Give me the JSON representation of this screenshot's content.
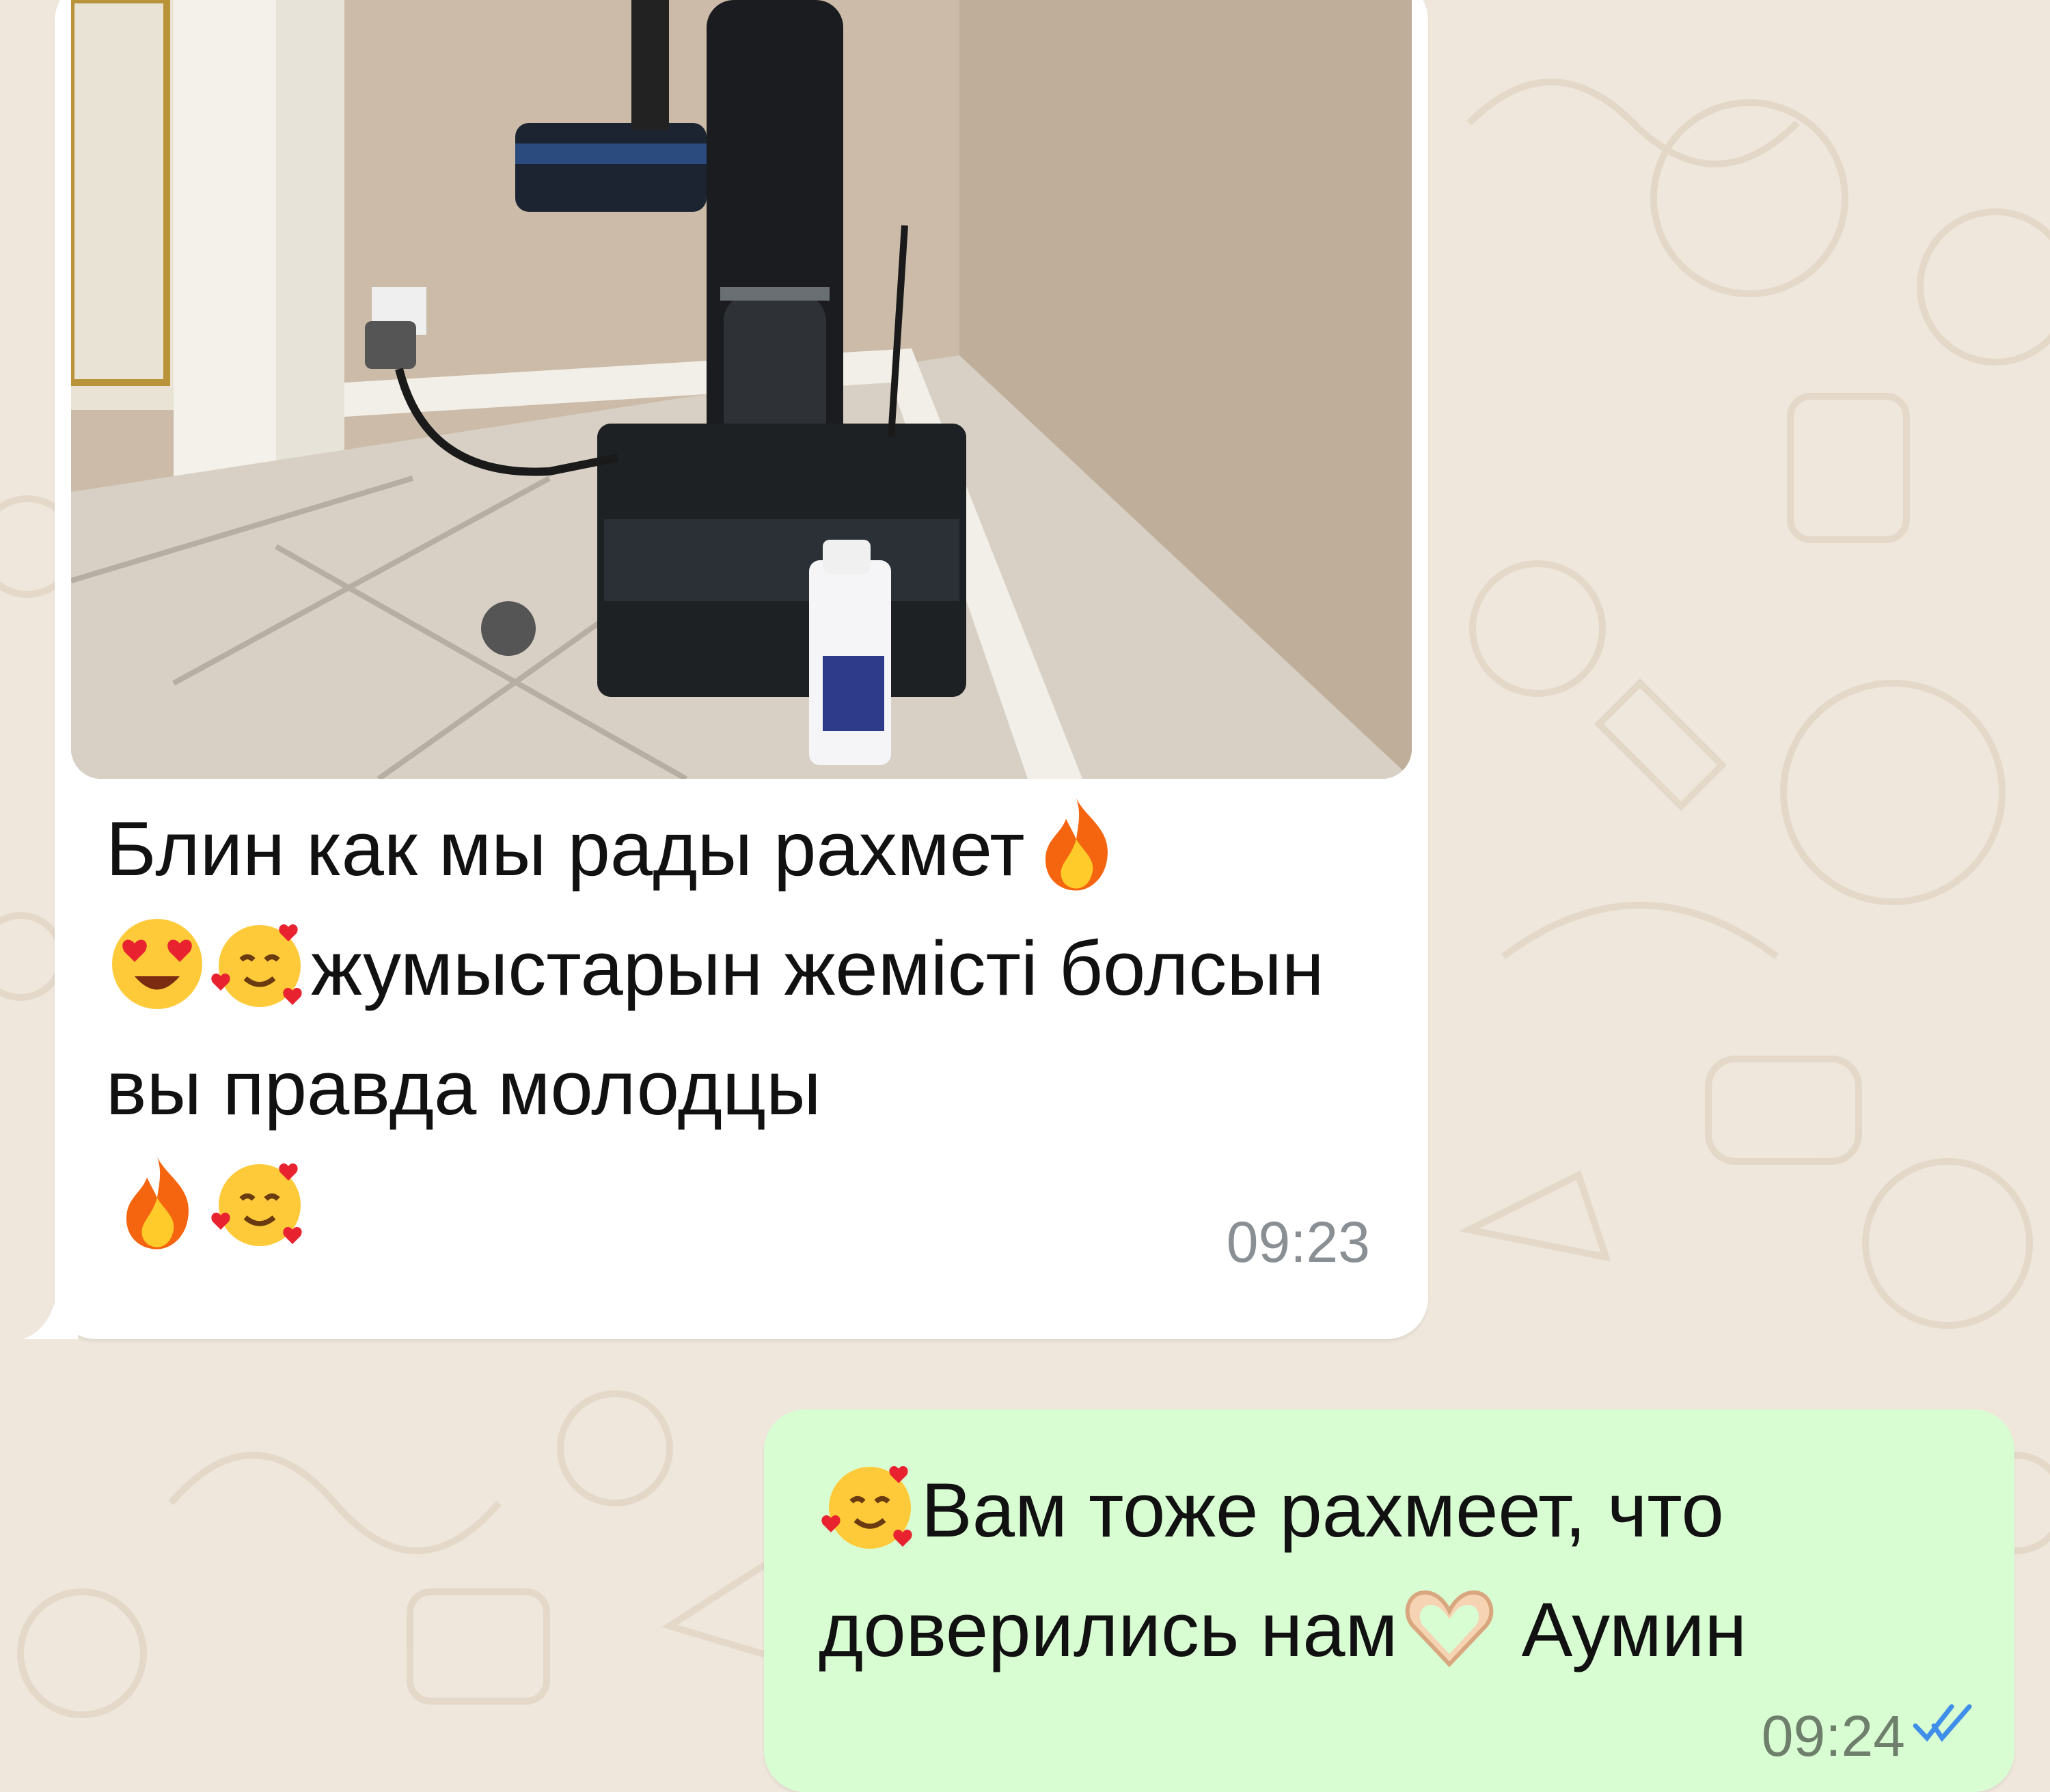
{
  "incoming": {
    "text_parts": [
      "Блин как мы рады рахмет",
      "жумыстарын жемісті болсын вы правда молодцы"
    ],
    "time": "09:23",
    "photo_alt": "robot-vacuum-photo"
  },
  "outgoing": {
    "text_parts": [
      "Вам тоже рахмеет, что доверились нам",
      " Аумин"
    ],
    "time": "09:24",
    "status": "read"
  },
  "colors": {
    "incoming_bubble": "#ffffff",
    "outgoing_bubble": "#d9fdd3",
    "wallpaper": "#efe7dc",
    "read_ticks": "#3f8fea"
  },
  "icons": [
    "fire-emoji",
    "heart-eyes-emoji",
    "smiling-hearts-emoji",
    "heart-hands-emoji",
    "double-check-icon"
  ]
}
